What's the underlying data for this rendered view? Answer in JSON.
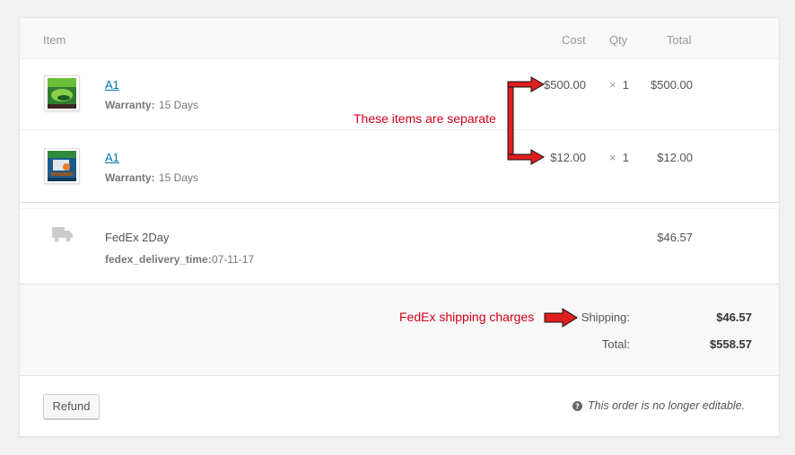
{
  "header": {
    "item": "Item",
    "cost": "Cost",
    "qty": "Qty",
    "total": "Total"
  },
  "items": [
    {
      "name": "A1",
      "warranty_label": "Warranty:",
      "warranty_value": "15 Days",
      "cost": "$500.00",
      "qty_symbol": "×",
      "qty": "1",
      "total": "$500.00"
    },
    {
      "name": "A1",
      "warranty_label": "Warranty:",
      "warranty_value": "15 Days",
      "cost": "$12.00",
      "qty_symbol": "×",
      "qty": "1",
      "total": "$12.00"
    }
  ],
  "shipping_line": {
    "method": "FedEx 2Day",
    "meta_label": "fedex_delivery_time:",
    "meta_value": "07-11-17",
    "total": "$46.57",
    "icon": "truck-icon"
  },
  "totals": {
    "shipping_label": "Shipping:",
    "shipping_value": "$46.57",
    "total_label": "Total:",
    "total_value": "$558.57"
  },
  "footer": {
    "refund_label": "Refund",
    "notice": "This order is no longer editable.",
    "notice_icon": "help-icon"
  },
  "annotations": {
    "items_note": "These items are separate",
    "shipping_note": "FedEx shipping charges",
    "color": "#d0011b"
  }
}
